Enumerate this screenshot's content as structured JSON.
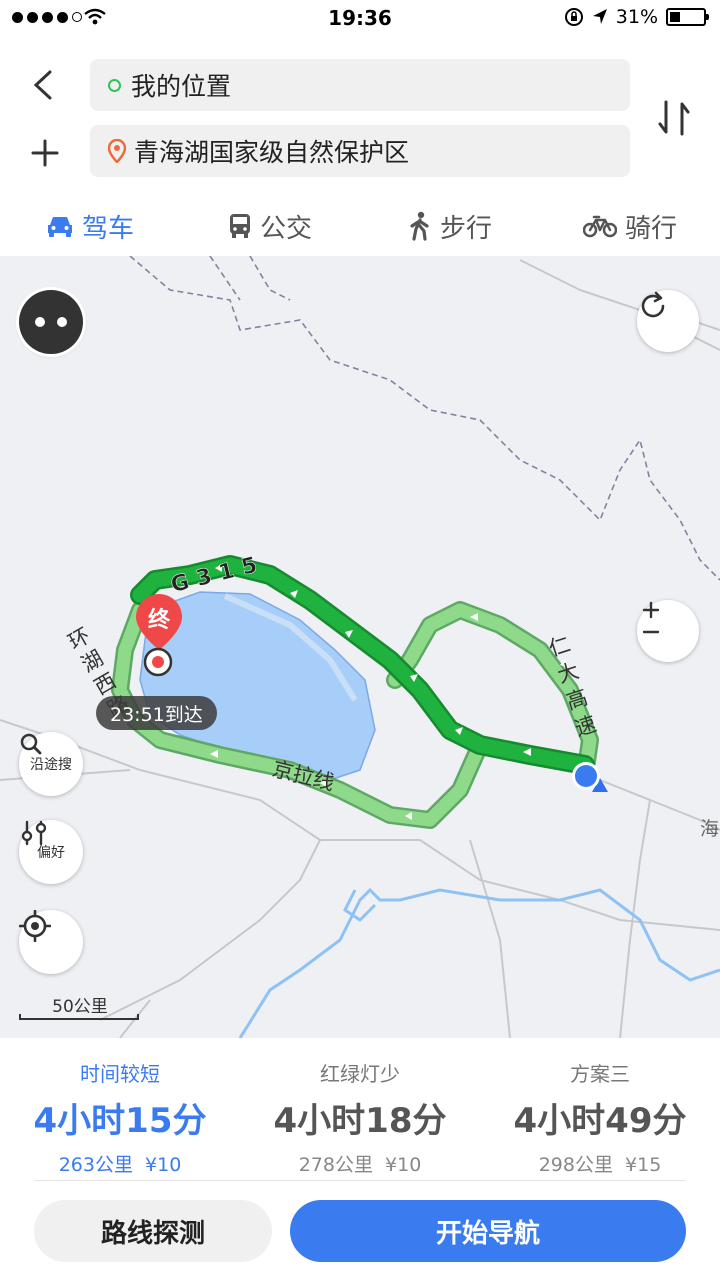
{
  "status_bar": {
    "time": "19:36",
    "battery": "31%",
    "battery_level": 0.31
  },
  "search": {
    "origin": "我的位置",
    "destination": "青海湖国家级自然保护区"
  },
  "tabs": [
    {
      "label": "驾车",
      "icon": "car-icon",
      "active": true
    },
    {
      "label": "公交",
      "icon": "bus-icon",
      "active": false
    },
    {
      "label": "步行",
      "icon": "walk-icon",
      "active": false
    },
    {
      "label": "骑行",
      "icon": "bike-icon",
      "active": false
    }
  ],
  "map": {
    "road_labels": {
      "g315": "G315",
      "renda": "仁大高速",
      "huanhu": "环湖西路",
      "jingla": "京拉线",
      "hai": "海"
    },
    "destination_marker": "终",
    "arrival": "23:51到达",
    "controls": {
      "along_route": "沿途搜",
      "preference": "偏好"
    },
    "scale": "50公里"
  },
  "routes": [
    {
      "label": "时间较短",
      "time": "4小时15分",
      "distance": "263公里",
      "toll": "¥10",
      "active": true
    },
    {
      "label": "红绿灯少",
      "time": "4小时18分",
      "distance": "278公里",
      "toll": "¥10",
      "active": false
    },
    {
      "label": "方案三",
      "time": "4小时49分",
      "distance": "298公里",
      "toll": "¥15",
      "active": false
    }
  ],
  "actions": {
    "probe": "路线探测",
    "start": "开始导航"
  },
  "colors": {
    "accent": "#3a7cf0",
    "route_main": "#1fb23e",
    "route_alt": "#8fd98a",
    "lake": "#a7cef8",
    "destination": "#f04848"
  }
}
